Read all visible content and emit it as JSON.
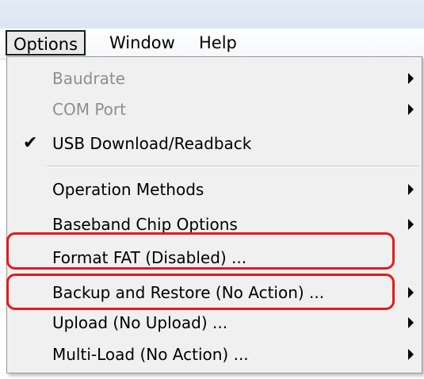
{
  "menubar": {
    "options": "Options",
    "window": "Window",
    "help": "Help"
  },
  "options_menu": {
    "items": [
      {
        "label": "Baudrate",
        "disabled": true,
        "submenu": true,
        "checked": false
      },
      {
        "label": "COM Port",
        "disabled": true,
        "submenu": true,
        "checked": false
      },
      {
        "label": "USB Download/Readback",
        "disabled": false,
        "submenu": false,
        "checked": true
      },
      {
        "label": "Operation Methods",
        "disabled": false,
        "submenu": true,
        "checked": false
      },
      {
        "label": "Baseband Chip Options",
        "disabled": false,
        "submenu": true,
        "checked": false
      },
      {
        "label": "Format FAT (Disabled) ...",
        "disabled": false,
        "submenu": false,
        "checked": false
      },
      {
        "label": "Backup and Restore (No Action) ...",
        "disabled": false,
        "submenu": true,
        "checked": false
      },
      {
        "label": "Upload (No Upload) ...",
        "disabled": false,
        "submenu": true,
        "checked": false
      },
      {
        "label": "Multi-Load (No Action) ...",
        "disabled": false,
        "submenu": true,
        "checked": false
      }
    ],
    "check_glyph": "✔"
  },
  "annotation_color": "#e31b1b",
  "highlighted_items": [
    "Format FAT (Disabled) ...",
    "Backup and Restore (No Action) ..."
  ]
}
